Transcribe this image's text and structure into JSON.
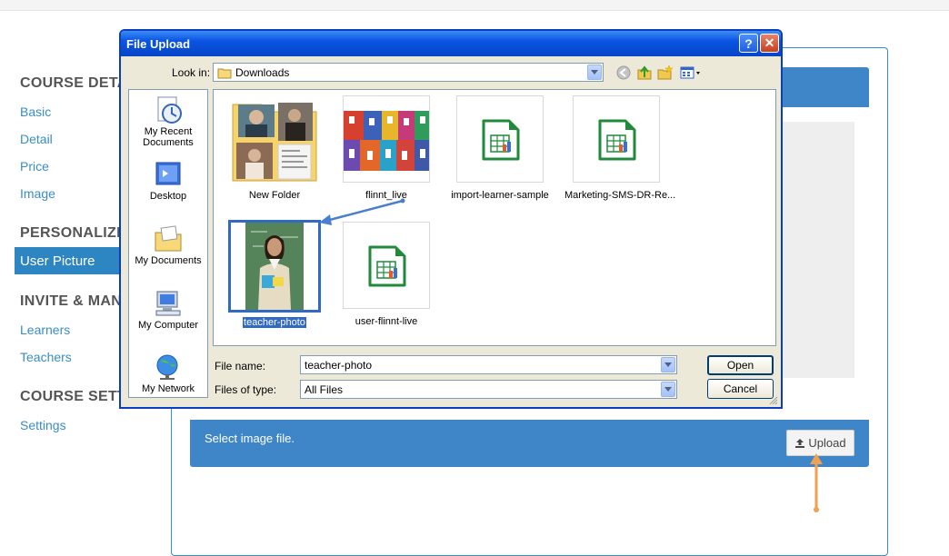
{
  "page": {
    "sidebar": {
      "sections": [
        {
          "heading": "COURSE DETA",
          "items": [
            "Basic",
            "Detail",
            "Price",
            "Image"
          ]
        },
        {
          "heading": "PERSONALIZE",
          "items": [
            "User Picture"
          ]
        },
        {
          "heading": "INVITE & MAN",
          "items": [
            "Learners",
            "Teachers"
          ]
        },
        {
          "heading": "COURSE SETTI",
          "items": [
            "Settings"
          ]
        }
      ],
      "active_item": "User Picture"
    },
    "panel": {
      "select_text": "Select image file.",
      "upload_label": "Upload"
    }
  },
  "dialog": {
    "title": "File Upload",
    "help_label": "?",
    "close_label": "✕",
    "look_in_label": "Look in:",
    "look_in_value": "Downloads",
    "places": [
      "My Recent Documents",
      "Desktop",
      "My Documents",
      "My Computer",
      "My Network"
    ],
    "files": [
      {
        "name": "New Folder",
        "kind": "folder"
      },
      {
        "name": "flinnt_live",
        "kind": "image"
      },
      {
        "name": "import-learner-sample",
        "kind": "spreadsheet"
      },
      {
        "name": "Marketing-SMS-DR-Re...",
        "kind": "spreadsheet"
      },
      {
        "name": "teacher-photo",
        "kind": "photo",
        "selected": true
      },
      {
        "name": "user-flinnt-live",
        "kind": "spreadsheet"
      }
    ],
    "file_name_label": "File name:",
    "file_name_value": "teacher-photo",
    "file_type_label": "Files of type:",
    "file_type_value": "All Files",
    "open_label": "Open",
    "cancel_label": "Cancel"
  },
  "colors": {
    "accent_blue": "#3f86c8",
    "link_blue": "#3a8cc6",
    "selection_blue": "#316ac5",
    "annotation_orange": "#f0a050",
    "titlebar_blue": "#0a54e2"
  }
}
